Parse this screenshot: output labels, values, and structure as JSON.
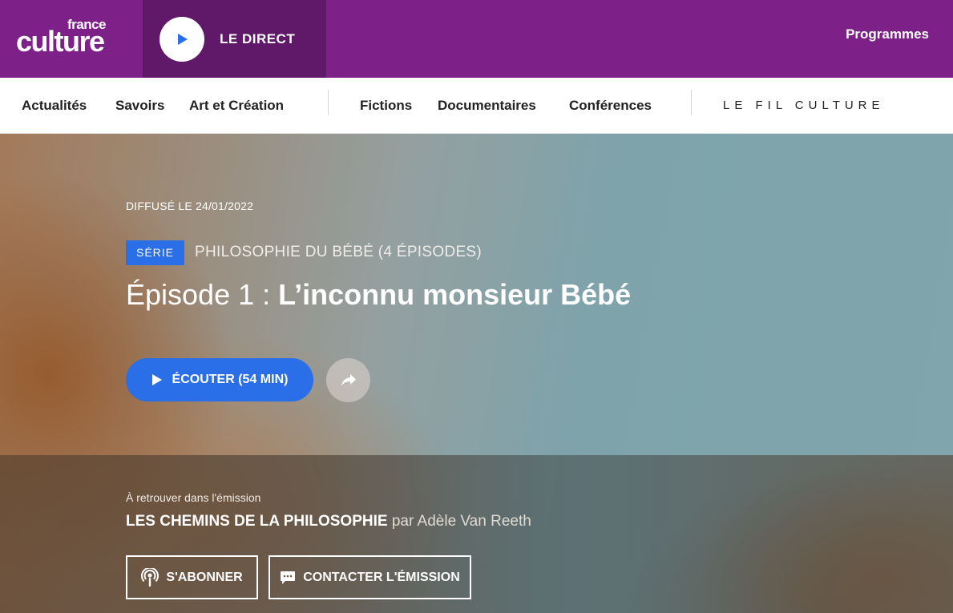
{
  "header": {
    "logo_small": "france",
    "logo_big": "culture",
    "direct_label": "LE DIRECT",
    "programmes_label": "Programmes",
    "brand_color": "#7d2189"
  },
  "nav": {
    "items": [
      "Actualités",
      "Savoirs",
      "Art et Création",
      "Fictions",
      "Documentaires",
      "Conférences"
    ],
    "fil_culture": "LE FIL CULTURE"
  },
  "episode": {
    "broadcast_date": "DIFFUSÉ LE 24/01/2022",
    "serie_badge": "SÉRIE",
    "serie_title": "PHILOSOPHIE DU BÉBÉ (4 ÉPISODES)",
    "episode_number": "Épisode 1 : ",
    "episode_name": "L’inconnu monsieur Bébé",
    "listen_label": "ÉCOUTER (54 MIN)",
    "share_icon": "share-icon",
    "accent_color": "#2a6ee8"
  },
  "emission": {
    "intro": "À retrouver dans l'émission",
    "name": "LES CHEMINS DE LA PHILOSOPHIE",
    "by": " par ",
    "author": "Adèle Van Reeth",
    "subscribe_label": "S'ABONNER",
    "contact_label": "CONTACTER L'ÉMISSION"
  }
}
